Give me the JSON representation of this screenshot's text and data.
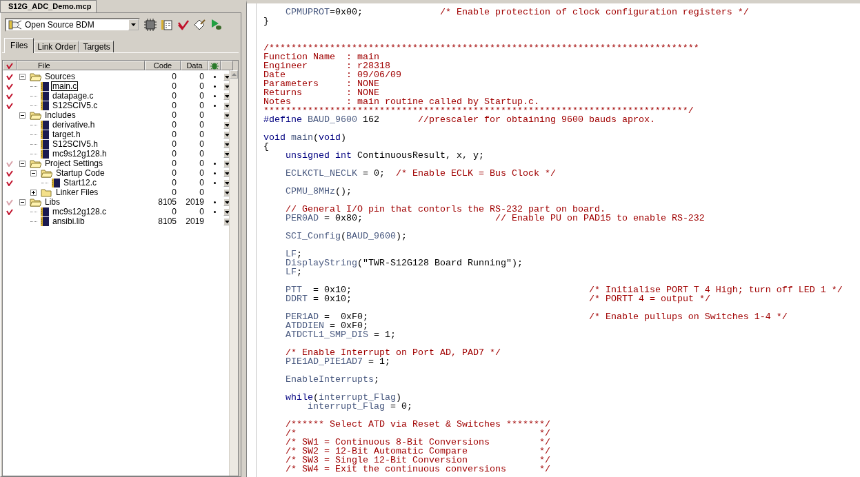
{
  "project_tab": {
    "label": "S12G_ADC_Demo.mcp"
  },
  "target_select": {
    "value": "Open Source BDM"
  },
  "tabs": [
    {
      "label": "Files",
      "selected": true
    },
    {
      "label": "Link Order",
      "selected": false
    },
    {
      "label": "Targets",
      "selected": false
    }
  ],
  "columns": {
    "file": "File",
    "code": "Code",
    "data": "Data"
  },
  "files": [
    {
      "kind": "group",
      "name": "Sources",
      "expanded": true,
      "checked": true,
      "partial": false,
      "code": "0",
      "data": "0",
      "debug": true,
      "children": [
        {
          "kind": "file",
          "name": "main.c",
          "focused": true,
          "checked": true,
          "partial": false,
          "code": "0",
          "data": "0",
          "debug": true
        },
        {
          "kind": "file",
          "name": "datapage.c",
          "focused": false,
          "checked": true,
          "partial": false,
          "code": "0",
          "data": "0",
          "debug": true
        },
        {
          "kind": "file",
          "name": "S12SCIV5.c",
          "focused": false,
          "checked": true,
          "partial": false,
          "code": "0",
          "data": "0",
          "debug": true
        }
      ]
    },
    {
      "kind": "group",
      "name": "Includes",
      "expanded": true,
      "checked": false,
      "code": "0",
      "data": "0",
      "debug": false,
      "children": [
        {
          "kind": "file",
          "name": "derivative.h",
          "focused": false,
          "checked": false,
          "code": "0",
          "data": "0",
          "debug": false
        },
        {
          "kind": "file",
          "name": "target.h",
          "focused": false,
          "checked": false,
          "code": "0",
          "data": "0",
          "debug": false
        },
        {
          "kind": "file",
          "name": "S12SCIV5.h",
          "focused": false,
          "checked": false,
          "code": "0",
          "data": "0",
          "debug": false
        },
        {
          "kind": "file",
          "name": "mc9s12g128.h",
          "focused": false,
          "checked": false,
          "code": "0",
          "data": "0",
          "debug": false
        }
      ]
    },
    {
      "kind": "group",
      "name": "Project Settings",
      "expanded": true,
      "checked": true,
      "partial": true,
      "code": "0",
      "data": "0",
      "debug": true,
      "children": [
        {
          "kind": "group",
          "name": "Startup Code",
          "expanded": true,
          "checked": true,
          "partial": false,
          "code": "0",
          "data": "0",
          "debug": true,
          "children": [
            {
              "kind": "file",
              "name": "Start12.c",
              "focused": false,
              "checked": true,
              "partial": false,
              "code": "0",
              "data": "0",
              "debug": true
            }
          ]
        },
        {
          "kind": "group",
          "name": "Linker Files",
          "expanded": false,
          "checked": false,
          "code": "0",
          "data": "0",
          "debug": false
        }
      ]
    },
    {
      "kind": "group",
      "name": "Libs",
      "expanded": true,
      "checked": true,
      "partial": true,
      "code": "8105",
      "data": "2019",
      "debug": true,
      "children": [
        {
          "kind": "file",
          "name": "mc9s12g128.c",
          "focused": false,
          "checked": true,
          "partial": false,
          "code": "0",
          "data": "0",
          "debug": true
        },
        {
          "kind": "file",
          "name": "ansibi.lib",
          "focused": false,
          "checked": false,
          "code": "8105",
          "data": "2019",
          "debug": false
        }
      ]
    }
  ],
  "code_lines": [
    {
      "kind": "code",
      "tokens": [
        {
          "kind": "ident",
          "text": "    CPMUPROT"
        },
        {
          "kind": "text",
          "text": "=0x00;              "
        },
        {
          "kind": "comment",
          "text": "/* Enable protection of clock configuration registers */"
        }
      ]
    },
    {
      "kind": "code",
      "tokens": [
        {
          "kind": "text",
          "text": "}"
        }
      ]
    },
    {
      "kind": "blank"
    },
    {
      "kind": "blank"
    },
    {
      "kind": "code",
      "tokens": [
        {
          "kind": "comment",
          "text": "/******************************************************************************"
        }
      ]
    },
    {
      "kind": "code",
      "tokens": [
        {
          "kind": "comment",
          "text": "Function Name  : main"
        }
      ]
    },
    {
      "kind": "code",
      "tokens": [
        {
          "kind": "comment",
          "text": "Engineer       : r28318"
        }
      ]
    },
    {
      "kind": "code",
      "tokens": [
        {
          "kind": "comment",
          "text": "Date           : 09/06/09"
        }
      ]
    },
    {
      "kind": "code",
      "tokens": [
        {
          "kind": "comment",
          "text": "Parameters     : NONE"
        }
      ]
    },
    {
      "kind": "code",
      "tokens": [
        {
          "kind": "comment",
          "text": "Returns        : NONE"
        }
      ]
    },
    {
      "kind": "code",
      "tokens": [
        {
          "kind": "comment",
          "text": "Notes          : main routine called by Startup.c."
        }
      ]
    },
    {
      "kind": "code",
      "tokens": [
        {
          "kind": "comment",
          "text": "*****************************************************************************/"
        }
      ]
    },
    {
      "kind": "code",
      "tokens": [
        {
          "kind": "keyword",
          "text": "#define "
        },
        {
          "kind": "ident",
          "text": "BAUD_9600"
        },
        {
          "kind": "text",
          "text": " 162       "
        },
        {
          "kind": "comment",
          "text": "//prescaler for obtaining 9600 bauds aprox."
        }
      ]
    },
    {
      "kind": "blank"
    },
    {
      "kind": "code",
      "tokens": [
        {
          "kind": "keyword",
          "text": "void "
        },
        {
          "kind": "ident",
          "text": "main"
        },
        {
          "kind": "text",
          "text": "("
        },
        {
          "kind": "keyword",
          "text": "void"
        },
        {
          "kind": "text",
          "text": ")"
        }
      ]
    },
    {
      "kind": "code",
      "tokens": [
        {
          "kind": "text",
          "text": "{"
        }
      ]
    },
    {
      "kind": "code",
      "tokens": [
        {
          "kind": "keyword",
          "text": "    unsigned int"
        },
        {
          "kind": "text",
          "text": " ContinuousResult, x, y;"
        }
      ]
    },
    {
      "kind": "blank"
    },
    {
      "kind": "code",
      "tokens": [
        {
          "kind": "ident",
          "text": "    ECLKCTL_NECLK"
        },
        {
          "kind": "text",
          "text": " = 0;  "
        },
        {
          "kind": "comment",
          "text": "/* Enable ECLK = Bus Clock */"
        }
      ]
    },
    {
      "kind": "blank"
    },
    {
      "kind": "code",
      "tokens": [
        {
          "kind": "ident",
          "text": "    CPMU_8MHz"
        },
        {
          "kind": "text",
          "text": "();"
        }
      ]
    },
    {
      "kind": "blank"
    },
    {
      "kind": "code",
      "tokens": [
        {
          "kind": "comment",
          "text": "    // General I/O pin that contorls the RS-232 part on board."
        }
      ]
    },
    {
      "kind": "code",
      "tokens": [
        {
          "kind": "ident",
          "text": "    PER0AD"
        },
        {
          "kind": "text",
          "text": " = 0x80;                        "
        },
        {
          "kind": "comment",
          "text": "// Enable PU on PAD15 to enable RS-232"
        }
      ]
    },
    {
      "kind": "blank"
    },
    {
      "kind": "code",
      "tokens": [
        {
          "kind": "ident",
          "text": "    SCI_Config"
        },
        {
          "kind": "text",
          "text": "("
        },
        {
          "kind": "ident",
          "text": "BAUD_9600"
        },
        {
          "kind": "text",
          "text": ");"
        }
      ]
    },
    {
      "kind": "blank"
    },
    {
      "kind": "code",
      "tokens": [
        {
          "kind": "ident",
          "text": "    LF"
        },
        {
          "kind": "text",
          "text": ";"
        }
      ]
    },
    {
      "kind": "code",
      "tokens": [
        {
          "kind": "ident",
          "text": "    DisplayString"
        },
        {
          "kind": "text",
          "text": "(\"TWR-S12G128 Board Running\");"
        }
      ]
    },
    {
      "kind": "code",
      "tokens": [
        {
          "kind": "ident",
          "text": "    LF"
        },
        {
          "kind": "text",
          "text": ";"
        }
      ]
    },
    {
      "kind": "blank"
    },
    {
      "kind": "code",
      "tokens": [
        {
          "kind": "ident",
          "text": "    PTT"
        },
        {
          "kind": "text",
          "text": "  = 0x10;                                           "
        },
        {
          "kind": "comment",
          "text": "/* Initialise PORT T 4 High; turn off LED 1 */"
        }
      ]
    },
    {
      "kind": "code",
      "tokens": [
        {
          "kind": "ident",
          "text": "    DDRT"
        },
        {
          "kind": "text",
          "text": " = 0x10;                                           "
        },
        {
          "kind": "comment",
          "text": "/* PORTT 4 = output */"
        }
      ]
    },
    {
      "kind": "blank"
    },
    {
      "kind": "code",
      "tokens": [
        {
          "kind": "ident",
          "text": "    PER1AD"
        },
        {
          "kind": "text",
          "text": " =  0xF0;                                        "
        },
        {
          "kind": "comment",
          "text": "/* Enable pullups on Switches 1-4 */"
        }
      ]
    },
    {
      "kind": "code",
      "tokens": [
        {
          "kind": "ident",
          "text": "    ATDDIEN"
        },
        {
          "kind": "text",
          "text": " = 0xF0;"
        }
      ]
    },
    {
      "kind": "code",
      "tokens": [
        {
          "kind": "ident",
          "text": "    ATDCTL1_SMP_DIS"
        },
        {
          "kind": "text",
          "text": " = 1;"
        }
      ]
    },
    {
      "kind": "blank"
    },
    {
      "kind": "code",
      "tokens": [
        {
          "kind": "comment",
          "text": "    /* Enable Interrupt on Port AD, PAD7 */"
        }
      ]
    },
    {
      "kind": "code",
      "tokens": [
        {
          "kind": "ident",
          "text": "    PIE1AD_PIE1AD7"
        },
        {
          "kind": "text",
          "text": " = 1;"
        }
      ]
    },
    {
      "kind": "blank"
    },
    {
      "kind": "code",
      "tokens": [
        {
          "kind": "ident",
          "text": "    EnableInterrupts"
        },
        {
          "kind": "text",
          "text": ";"
        }
      ]
    },
    {
      "kind": "blank"
    },
    {
      "kind": "code",
      "tokens": [
        {
          "kind": "keyword",
          "text": "    while"
        },
        {
          "kind": "text",
          "text": "("
        },
        {
          "kind": "ident",
          "text": "interrupt_Flag"
        },
        {
          "kind": "text",
          "text": ")"
        }
      ]
    },
    {
      "kind": "code",
      "tokens": [
        {
          "kind": "ident",
          "text": "        interrupt_Flag"
        },
        {
          "kind": "text",
          "text": " = 0;"
        }
      ]
    },
    {
      "kind": "blank"
    },
    {
      "kind": "code",
      "tokens": [
        {
          "kind": "comment",
          "text": "    /****** Select ATD via Reset & Switches *******/"
        }
      ]
    },
    {
      "kind": "code",
      "tokens": [
        {
          "kind": "comment",
          "text": "    /*                                            */"
        }
      ]
    },
    {
      "kind": "code",
      "tokens": [
        {
          "kind": "comment",
          "text": "    /* SW1 = Continuous 8-Bit Conversions         */"
        }
      ]
    },
    {
      "kind": "code",
      "tokens": [
        {
          "kind": "comment",
          "text": "    /* SW2 = 12-Bit Automatic Compare             */"
        }
      ]
    },
    {
      "kind": "code",
      "tokens": [
        {
          "kind": "comment",
          "text": "    /* SW3 = Single 12-Bit Conversion             */"
        }
      ]
    },
    {
      "kind": "code",
      "tokens": [
        {
          "kind": "comment",
          "text": "    /* SW4 = Exit the continuous conversions      */"
        }
      ]
    }
  ]
}
